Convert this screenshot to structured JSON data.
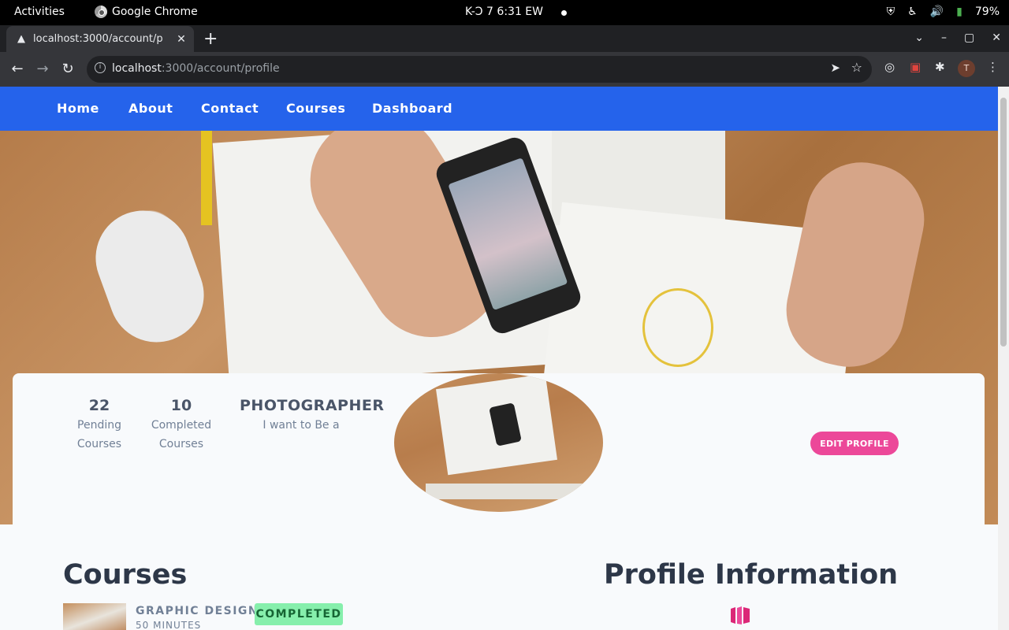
{
  "system": {
    "activities": "Activities",
    "app_name": "Google Chrome",
    "clock": "K-Ͻ 7   6:31 EW",
    "battery": "79%"
  },
  "browser": {
    "tab_title": "localhost:3000/account/p",
    "url_host": "localhost",
    "url_path": ":3000/account/profile",
    "profile_initial": "T"
  },
  "nav": {
    "items": [
      "Home",
      "About",
      "Contact",
      "Courses",
      "Dashboard"
    ]
  },
  "stats": {
    "pending": {
      "value": "22",
      "label_1": "Pending",
      "label_2": "Courses"
    },
    "completed": {
      "value": "10",
      "label_1": "Completed",
      "label_2": "Courses"
    },
    "role": {
      "value": "PHOTOGRAPHER",
      "label": "I want to Be a"
    }
  },
  "edit_profile_label": "EDIT PROFILE",
  "courses": {
    "heading": "Courses",
    "items": [
      {
        "name": "GRAPHIC DESIGN",
        "duration": "50 MINUTES",
        "status": "COMPLETED"
      }
    ]
  },
  "profile_info": {
    "heading": "Profile Information"
  },
  "colors": {
    "navbar": "#2563eb",
    "accent_pink": "#ec4899",
    "badge_green": "#86efac"
  }
}
